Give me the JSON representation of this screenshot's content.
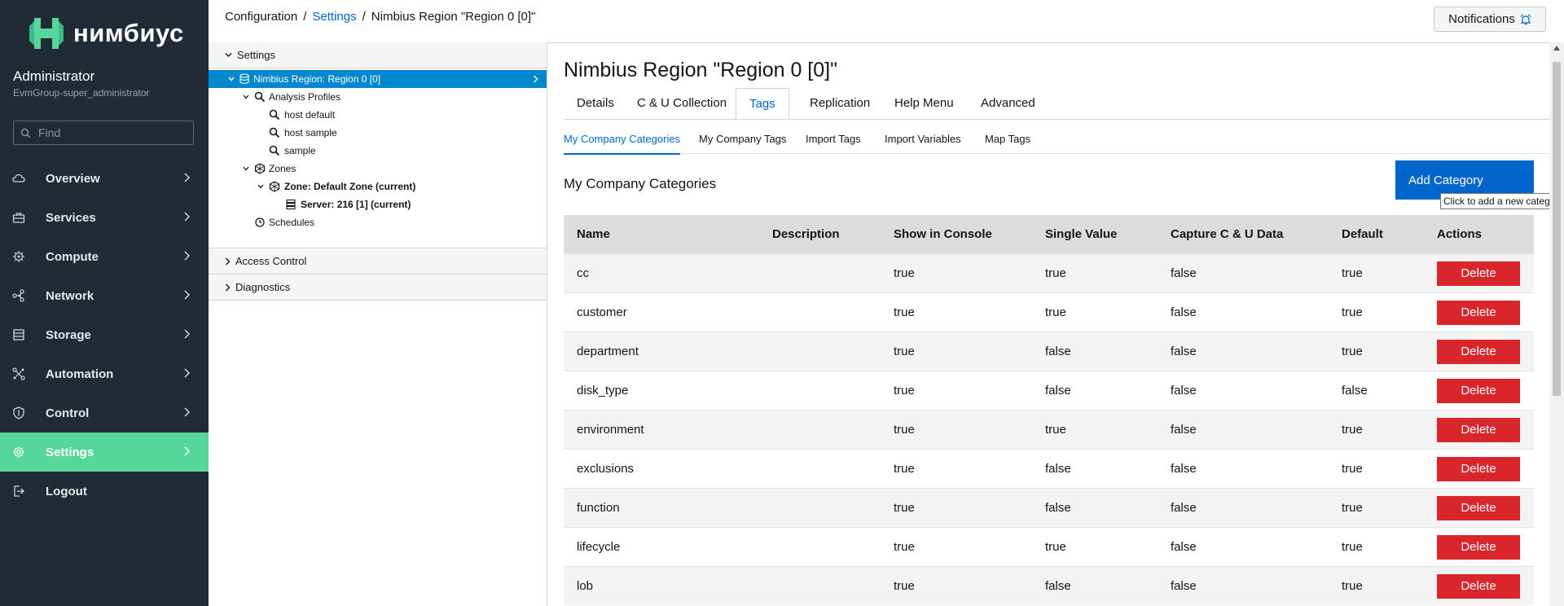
{
  "app": {
    "brand": "нимбиус"
  },
  "user": {
    "name": "Administrator",
    "group": "EvmGroup-super_administrator"
  },
  "search": {
    "placeholder": "Find"
  },
  "nav": {
    "items": [
      {
        "label": "Overview",
        "icon": "cloud-icon"
      },
      {
        "label": "Services",
        "icon": "briefcase-icon"
      },
      {
        "label": "Compute",
        "icon": "chip-icon"
      },
      {
        "label": "Network",
        "icon": "network-icon"
      },
      {
        "label": "Storage",
        "icon": "database-icon"
      },
      {
        "label": "Automation",
        "icon": "automation-icon"
      },
      {
        "label": "Control",
        "icon": "shield-icon"
      },
      {
        "label": "Settings",
        "icon": "gear-icon",
        "active": true
      },
      {
        "label": "Logout",
        "icon": "logout-icon"
      }
    ]
  },
  "breadcrumb": {
    "items": [
      "Configuration",
      "Settings",
      "Nimbius Region \"Region 0 [0]\""
    ]
  },
  "notifications": {
    "label": "Notifications"
  },
  "tree": {
    "settings_header": "Settings",
    "nodes": {
      "region": "Nimbius Region: Region 0 [0]",
      "analysis_profiles": "Analysis Profiles",
      "host_default": "host default",
      "host_sample": "host sample",
      "sample": "sample",
      "zones": "Zones",
      "zone_default": "Zone: Default Zone (current)",
      "server": "Server: 216 [1] (current)",
      "schedules": "Schedules"
    },
    "access_control": "Access Control",
    "diagnostics": "Diagnostics"
  },
  "page": {
    "title": "Nimbius Region \"Region 0 [0]\""
  },
  "tabs": [
    "Details",
    "C & U Collection",
    "Tags",
    "Replication",
    "Help Menu",
    "Advanced"
  ],
  "active_tab": "Tags",
  "subtabs": [
    "My Company Categories",
    "My Company Tags",
    "Import Tags",
    "Import Variables",
    "Map Tags"
  ],
  "active_subtab": "My Company Categories",
  "section": {
    "title": "My Company Categories",
    "add_label": "Add Category",
    "add_tooltip": "Click to add a new category"
  },
  "table": {
    "headers": [
      "Name",
      "Description",
      "Show in Console",
      "Single Value",
      "Capture C & U Data",
      "Default",
      "Actions"
    ],
    "delete_label": "Delete",
    "rows": [
      {
        "name": "cc",
        "description": "",
        "show": "true",
        "single": "true",
        "capture": "false",
        "default": "true"
      },
      {
        "name": "customer",
        "description": "",
        "show": "true",
        "single": "true",
        "capture": "false",
        "default": "true"
      },
      {
        "name": "department",
        "description": "",
        "show": "true",
        "single": "false",
        "capture": "false",
        "default": "true"
      },
      {
        "name": "disk_type",
        "description": "",
        "show": "true",
        "single": "false",
        "capture": "false",
        "default": "false"
      },
      {
        "name": "environment",
        "description": "",
        "show": "true",
        "single": "true",
        "capture": "false",
        "default": "true"
      },
      {
        "name": "exclusions",
        "description": "",
        "show": "true",
        "single": "false",
        "capture": "false",
        "default": "true"
      },
      {
        "name": "function",
        "description": "",
        "show": "true",
        "single": "false",
        "capture": "false",
        "default": "true"
      },
      {
        "name": "lifecycle",
        "description": "",
        "show": "true",
        "single": "true",
        "capture": "false",
        "default": "true"
      },
      {
        "name": "lob",
        "description": "",
        "show": "true",
        "single": "false",
        "capture": "false",
        "default": "true"
      }
    ]
  },
  "colors": {
    "sidebar_bg": "#212b36",
    "active_nav": "#56d79a",
    "primary": "#0066cc",
    "danger": "#d9262c",
    "tree_selected": "#0088ce"
  }
}
